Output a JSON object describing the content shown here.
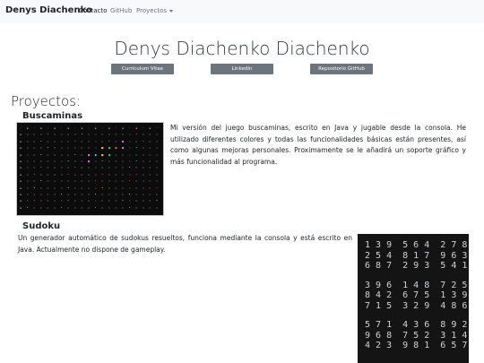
{
  "navbar": {
    "brand": "Denys Diachenko",
    "links": [
      {
        "label": "Contacto"
      },
      {
        "label": "GitHub"
      },
      {
        "label": "Proyectos"
      }
    ]
  },
  "header": {
    "title": "Denys Diachenko Diachenko",
    "buttons": [
      {
        "label": "Currículum Vitae"
      },
      {
        "label": "LinkedIn"
      },
      {
        "label": "Repositorio GitHub"
      }
    ]
  },
  "projects": {
    "heading": "Proyectos:",
    "items": [
      {
        "title": "Buscaminas",
        "description": "Mi versión del juego buscaminas, escrito en Java y jugable desde la consola. He utilizado diferentes colores y todas las funcionalidades básicas están presentes, así como algunas mejoras personales. Proximamente se le añadirá un soporte gráfico y más funcionalidad al programa."
      },
      {
        "title": "Sudoku",
        "description": "Un generador automático de sudokus resueltos, funciona mediante la consola y está escrito en Java. Actualmente no dispone de gameplay."
      }
    ]
  },
  "sudoku_rows": [
    "139 564 278",
    "254 817 963",
    "687 293 541",
    "",
    "396 148 725",
    "842 675 139",
    "715 329 486",
    "",
    "571 436 892",
    "968 752 314",
    "423 981 657"
  ]
}
